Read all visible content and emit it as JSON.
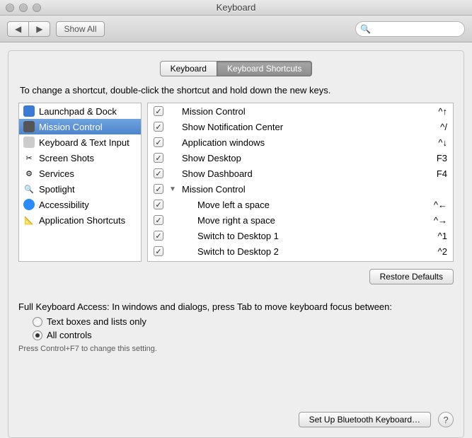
{
  "window": {
    "title": "Keyboard"
  },
  "toolbar": {
    "back_glyph": "◀",
    "forward_glyph": "▶",
    "showall_label": "Show All",
    "search_placeholder": ""
  },
  "tabs": [
    {
      "label": "Keyboard",
      "selected": false
    },
    {
      "label": "Keyboard Shortcuts",
      "selected": true
    }
  ],
  "instruction": "To change a shortcut, double-click the shortcut and hold down the new keys.",
  "categories": [
    {
      "label": "Launchpad & Dock",
      "icon_bg": "#3a7bd5",
      "selected": false
    },
    {
      "label": "Mission Control",
      "icon_bg": "#6b6b6b",
      "selected": true
    },
    {
      "label": "Keyboard & Text Input",
      "icon_bg": "#cccccc",
      "selected": false
    },
    {
      "label": "Screen Shots",
      "icon_bg": "transparent",
      "icon_glyph": "✂",
      "selected": false
    },
    {
      "label": "Services",
      "icon_bg": "transparent",
      "icon_glyph": "⚙",
      "selected": false
    },
    {
      "label": "Spotlight",
      "icon_bg": "#2a8bff",
      "icon_glyph": "🔍",
      "selected": false
    },
    {
      "label": "Accessibility",
      "icon_bg": "#2a8bff",
      "icon_glyph": "",
      "selected": false
    },
    {
      "label": "Application Shortcuts",
      "icon_bg": "transparent",
      "icon_glyph": "📐",
      "selected": false
    }
  ],
  "shortcuts": [
    {
      "checked": true,
      "label": "Mission Control",
      "keys": "^↑",
      "indent": false,
      "disclosure": ""
    },
    {
      "checked": true,
      "label": "Show Notification Center",
      "keys": "^/",
      "indent": false,
      "disclosure": ""
    },
    {
      "checked": true,
      "label": "Application windows",
      "keys": "^↓",
      "indent": false,
      "disclosure": ""
    },
    {
      "checked": true,
      "label": "Show Desktop",
      "keys": "F3",
      "indent": false,
      "disclosure": ""
    },
    {
      "checked": true,
      "label": "Show Dashboard",
      "keys": "F4",
      "indent": false,
      "disclosure": ""
    },
    {
      "checked": true,
      "label": "Mission Control",
      "keys": "",
      "indent": false,
      "disclosure": "▼"
    },
    {
      "checked": true,
      "label": "Move left a space",
      "keys": "^←",
      "indent": true,
      "disclosure": ""
    },
    {
      "checked": true,
      "label": "Move right a space",
      "keys": "^→",
      "indent": true,
      "disclosure": ""
    },
    {
      "checked": true,
      "label": "Switch to Desktop 1",
      "keys": "^1",
      "indent": true,
      "disclosure": ""
    },
    {
      "checked": true,
      "label": "Switch to Desktop 2",
      "keys": "^2",
      "indent": true,
      "disclosure": ""
    }
  ],
  "restore_label": "Restore Defaults",
  "fka": {
    "heading": "Full Keyboard Access: In windows and dialogs, press Tab to move keyboard focus between:",
    "options": [
      {
        "label": "Text boxes and lists only",
        "checked": false
      },
      {
        "label": "All controls",
        "checked": true
      }
    ],
    "hint": "Press Control+F7 to change this setting."
  },
  "footer": {
    "bluetooth_label": "Set Up Bluetooth Keyboard…",
    "help_glyph": "?"
  }
}
